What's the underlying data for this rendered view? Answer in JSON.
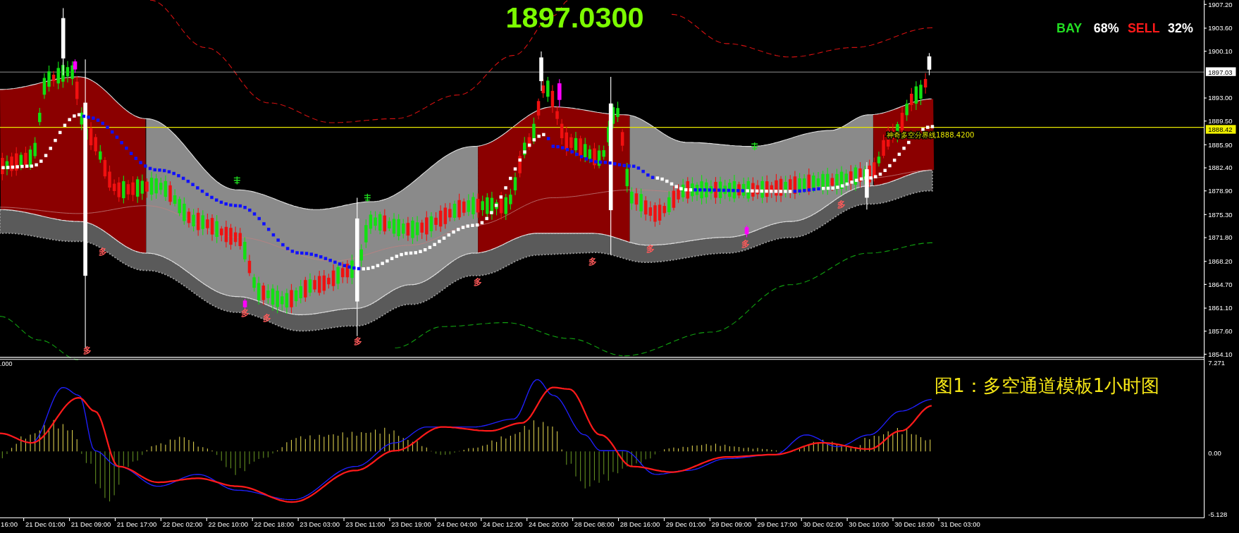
{
  "price_readout": "1897.0300",
  "sentiment": {
    "buy_label": "BAY",
    "buy_percent": "68%",
    "sell_label": "SELL",
    "sell_percent": "32%"
  },
  "main_chart": {
    "price_axis": [
      "1907.20",
      "1903.60",
      "1900.10",
      "1893.00",
      "1889.50",
      "1885.90",
      "1882.40",
      "1878.90",
      "1875.30",
      "1871.80",
      "1868.20",
      "1864.70",
      "1861.10",
      "1857.60",
      "1854.10"
    ],
    "current_price": "1897.03",
    "divider_price": "1888.42",
    "divider_label": "神奇多空分界线1888.4200",
    "signal_marks": [
      "多",
      "多",
      "多",
      "多",
      "多",
      "多",
      "多",
      "多",
      "多",
      "多"
    ]
  },
  "indicator": {
    "scale_label": ".000",
    "axis": [
      "7.271",
      "0.00",
      "-5.128"
    ],
    "caption": "图1：多空通道模板1小时图"
  },
  "time_axis": [
    "16:00",
    "21 Dec 01:00",
    "21 Dec 09:00",
    "21 Dec 17:00",
    "22 Dec 02:00",
    "22 Dec 10:00",
    "22 Dec 18:00",
    "23 Dec 03:00",
    "23 Dec 11:00",
    "23 Dec 19:00",
    "24 Dec 04:00",
    "24 Dec 12:00",
    "24 Dec 20:00",
    "28 Dec 08:00",
    "28 Dec 16:00",
    "29 Dec 01:00",
    "29 Dec 09:00",
    "29 Dec 17:00",
    "30 Dec 02:00",
    "30 Dec 10:00",
    "30 Dec 18:00",
    "31 Dec 03:00"
  ]
}
